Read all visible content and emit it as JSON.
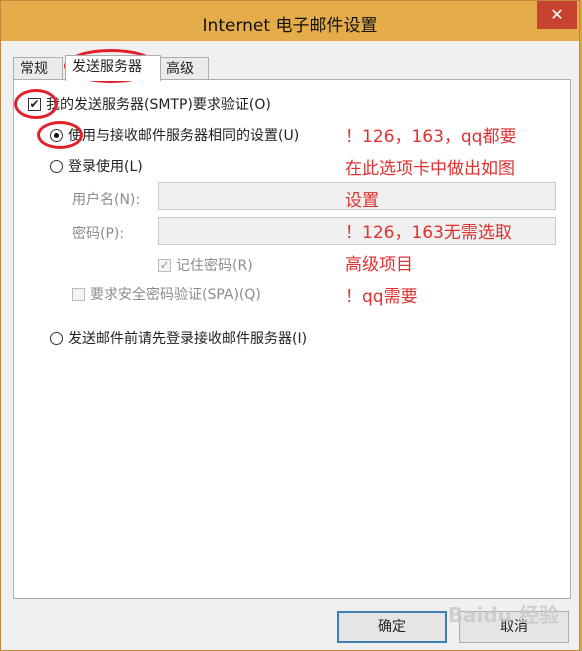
{
  "window": {
    "title": "Internet 电子邮件设置",
    "close_glyph": "✕"
  },
  "tabs": [
    {
      "label": "常规",
      "active": false
    },
    {
      "label": "发送服务器",
      "active": true
    },
    {
      "label": "高级",
      "active": false
    }
  ],
  "panel": {
    "smtp_auth": {
      "label": "我的发送服务器(SMTP)要求验证(O)",
      "checked": true
    },
    "same_settings": {
      "label": "使用与接收邮件服务器相同的设置(U)",
      "selected": true
    },
    "login_with": {
      "label": "登录使用(L)",
      "selected": false
    },
    "username": {
      "label": "用户名(N):",
      "value": ""
    },
    "password": {
      "label": "密码(P):",
      "value": ""
    },
    "remember_password": {
      "label": "记住密码(R)",
      "checked": true,
      "check_glyph": "✓"
    },
    "spa": {
      "label": "要求安全密码验证(SPA)(Q)",
      "checked": false
    },
    "login_before_send": {
      "label": "发送邮件前请先登录接收邮件服务器(I)",
      "selected": false
    },
    "check_glyph": "✔"
  },
  "annotations": [
    "！126，163，qq都要",
    "在此选项卡中做出如图",
    "设置",
    "！126，163无需选取",
    "高级项目",
    "！qq需要"
  ],
  "buttons": {
    "ok": "确定",
    "cancel": "取消"
  },
  "watermark": "Baidu 经验",
  "colors": {
    "title_bar": "#e4ad4a",
    "close_button": "#c7432f",
    "annotation_red": "#e03030",
    "default_button_border": "#3c7fb1"
  }
}
